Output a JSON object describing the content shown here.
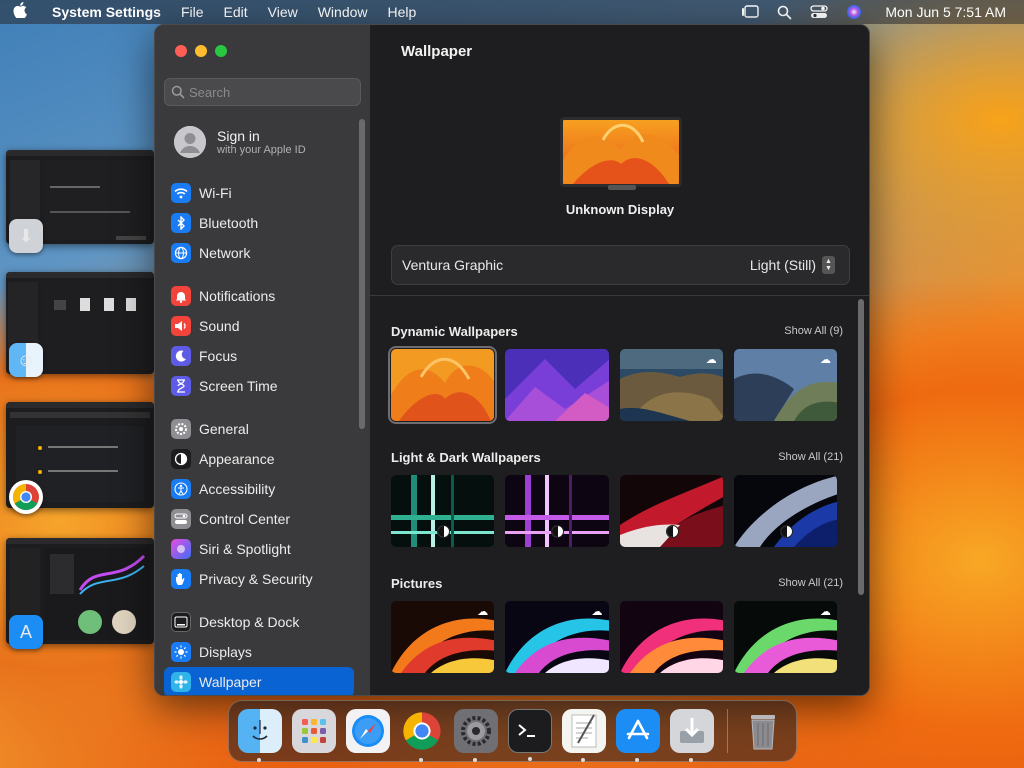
{
  "menubar": {
    "app_name": "System Settings",
    "menus": [
      "File",
      "Edit",
      "View",
      "Window",
      "Help"
    ],
    "clock": "Mon Jun 5  7:51 AM"
  },
  "window": {
    "search_placeholder": "Search",
    "signin": {
      "title": "Sign in",
      "subtitle": "with your Apple ID"
    },
    "sidebar": {
      "group1": [
        {
          "label": "Wi-Fi",
          "icon": "wifi-icon",
          "color": "#1a7cf5"
        },
        {
          "label": "Bluetooth",
          "icon": "bluetooth-icon",
          "color": "#1a7cf5"
        },
        {
          "label": "Network",
          "icon": "globe-icon",
          "color": "#1a7cf5"
        }
      ],
      "group2": [
        {
          "label": "Notifications",
          "icon": "bell-icon",
          "color": "#f2443a"
        },
        {
          "label": "Sound",
          "icon": "speaker-icon",
          "color": "#f2443a"
        },
        {
          "label": "Focus",
          "icon": "moon-icon",
          "color": "#5e5ce6"
        },
        {
          "label": "Screen Time",
          "icon": "hourglass-icon",
          "color": "#5e5ce6"
        }
      ],
      "group3": [
        {
          "label": "General",
          "icon": "gear-icon",
          "color": "#8e8e93"
        },
        {
          "label": "Appearance",
          "icon": "appearance-icon",
          "color": "#1c1c1e"
        },
        {
          "label": "Accessibility",
          "icon": "accessibility-icon",
          "color": "#1a7cf5"
        },
        {
          "label": "Control Center",
          "icon": "control-center-icon",
          "color": "#8e8e93"
        },
        {
          "label": "Siri & Spotlight",
          "icon": "siri-icon",
          "color": "#b34ce0"
        },
        {
          "label": "Privacy & Security",
          "icon": "hand-icon",
          "color": "#1a7cf5"
        }
      ],
      "group4": [
        {
          "label": "Desktop & Dock",
          "icon": "dock-icon",
          "color": "#1c1c1e"
        },
        {
          "label": "Displays",
          "icon": "sun-icon",
          "color": "#1a7cf5"
        },
        {
          "label": "Wallpaper",
          "icon": "wallpaper-icon",
          "color": "#2fb3e8"
        }
      ]
    },
    "main": {
      "title": "Wallpaper",
      "display_name": "Unknown Display",
      "chooser": {
        "name": "Ventura Graphic",
        "value": "Light (Still)"
      },
      "sections": [
        {
          "heading": "Dynamic Wallpapers",
          "show_all": "Show All (9)"
        },
        {
          "heading": "Light & Dark Wallpapers",
          "show_all": "Show All (21)"
        },
        {
          "heading": "Pictures",
          "show_all": "Show All (21)"
        }
      ]
    }
  },
  "dock": {
    "apps": [
      "finder-icon",
      "launchpad-icon",
      "safari-icon",
      "chrome-icon",
      "settings-icon",
      "terminal-icon",
      "textedit-icon",
      "app-store-icon",
      "installer-icon",
      "trash-icon"
    ]
  }
}
